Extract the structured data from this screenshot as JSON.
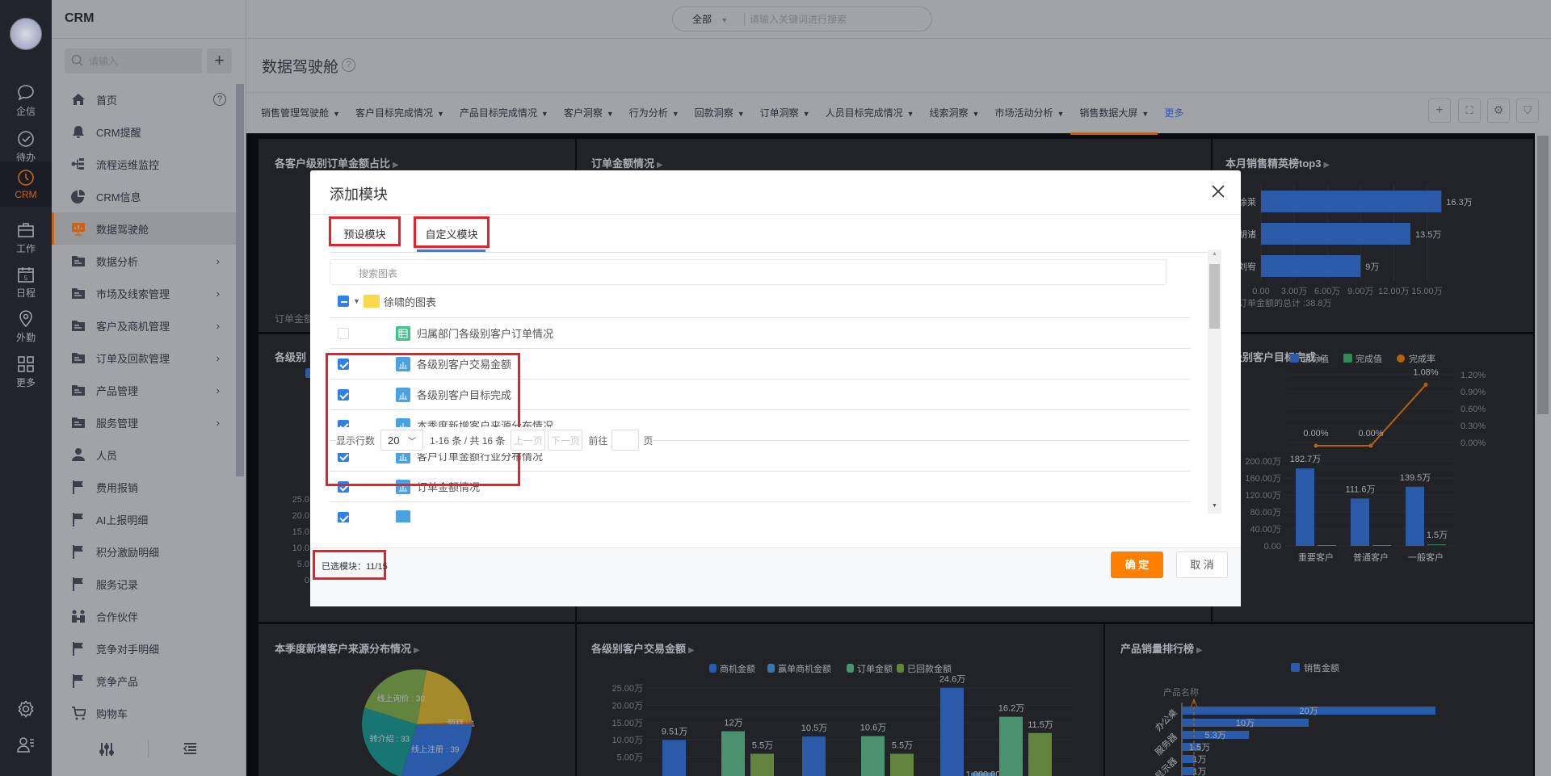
{
  "topbar": {
    "app_title": "CRM",
    "scope": "全部",
    "search_placeholder": "请输入关键词进行搜索"
  },
  "iconbar": {
    "items": [
      {
        "label": "企信",
        "icon": "chat-icon"
      },
      {
        "label": "待办",
        "icon": "check-circle-icon"
      },
      {
        "label": "CRM",
        "icon": "clock-icon",
        "active": true
      },
      {
        "label": "工作",
        "icon": "briefcase-icon"
      },
      {
        "label": "日程",
        "icon": "calendar-icon"
      },
      {
        "label": "外勤",
        "icon": "location-icon"
      },
      {
        "label": "更多",
        "icon": "grid-icon"
      }
    ]
  },
  "sidebar": {
    "search_placeholder": "请输入",
    "items": [
      {
        "label": "首页",
        "icon": "home-icon",
        "help": "?"
      },
      {
        "label": "CRM提醒",
        "icon": "bell-icon"
      },
      {
        "label": "流程运维监控",
        "icon": "flow-icon"
      },
      {
        "label": "CRM信息",
        "icon": "pie-icon"
      },
      {
        "label": "数据驾驶舱",
        "icon": "dashboard-icon",
        "active": true
      },
      {
        "label": "数据分析",
        "icon": "folder-icon",
        "children": true
      },
      {
        "label": "市场及线索管理",
        "icon": "folder-icon",
        "children": true
      },
      {
        "label": "客户及商机管理",
        "icon": "folder-icon",
        "children": true
      },
      {
        "label": "订单及回款管理",
        "icon": "folder-icon",
        "children": true
      },
      {
        "label": "产品管理",
        "icon": "folder-icon",
        "children": true
      },
      {
        "label": "服务管理",
        "icon": "folder-icon",
        "children": true
      },
      {
        "label": "人员",
        "icon": "user-icon"
      },
      {
        "label": "费用报销",
        "icon": "flag-icon"
      },
      {
        "label": "AI上报明细",
        "icon": "flag-icon"
      },
      {
        "label": "积分激励明细",
        "icon": "flag-icon"
      },
      {
        "label": "服务记录",
        "icon": "flag-icon"
      },
      {
        "label": "合作伙伴",
        "icon": "partners-icon"
      },
      {
        "label": "竞争对手明细",
        "icon": "flag-icon"
      },
      {
        "label": "竞争产品",
        "icon": "flag-icon"
      },
      {
        "label": "购物车",
        "icon": "cart-icon"
      }
    ]
  },
  "page": {
    "title": "数据驾驶舱",
    "tabs": [
      "销售管理驾驶舱",
      "客户目标完成情况",
      "产品目标完成情况",
      "客户洞察",
      "行为分析",
      "回款洞察",
      "订单洞察",
      "人员目标完成情况",
      "线索洞察",
      "市场活动分析",
      "销售数据大屏"
    ],
    "active_tab": 10,
    "more_label": "更多"
  },
  "dashboard": {
    "order_share": {
      "title": "各客户级别订单金额占比",
      "footer": "订单金额"
    },
    "order_amount": {
      "title": "订单金额情况"
    },
    "level_partial": {
      "title": "各级别",
      "yticks": [
        "25.0",
        "20.0",
        "15.0",
        "10.0",
        "5.0",
        "0"
      ]
    },
    "top3": {
      "title": "本月销售精英榜top3",
      "names": [
        "徐莱",
        "胡诸",
        "刘宥"
      ],
      "values": [
        16.3,
        13.5,
        9
      ],
      "value_labels": [
        "16.3万",
        "13.5万",
        "9万"
      ],
      "xticks": [
        "0.00",
        "3.00万",
        "6.00万",
        "9.00万",
        "12.00万",
        "15.00万"
      ],
      "xmax": 18,
      "footer": "订单金额的总计 :38.8万"
    },
    "target": {
      "title": "各级别客户目标完成",
      "legend": [
        "目标值",
        "完成值",
        "完成率"
      ],
      "categories": [
        "重要客户",
        "普通客户",
        "一般客户"
      ],
      "target_values": [
        182.7,
        111.6,
        139.5
      ],
      "target_labels": [
        "182.7万",
        "111.6万",
        "139.5万"
      ],
      "done_values": [
        0,
        0,
        1.5
      ],
      "done_labels": [
        "",
        "",
        "1.5万"
      ],
      "rate_values": [
        0,
        0,
        1.08
      ],
      "rate_labels": [
        "0.00%",
        "0.00%",
        "1.08%"
      ],
      "left_ticks": [
        "200.00万",
        "160.00万",
        "120.00万",
        "80.00万",
        "40.00万",
        "0.00"
      ],
      "right_ticks": [
        "1.20%",
        "0.90%",
        "0.60%",
        "0.30%",
        "0.00%"
      ]
    },
    "source": {
      "title": "本季度新增客户来源分布情况",
      "slices": [
        {
          "name": "",
          "value": 28,
          "label": "",
          "color": "#a48a2a"
        },
        {
          "name": "陌拜",
          "value": 1,
          "label": "陌拜 : 1",
          "color": "#b85f14"
        },
        {
          "name": "线上注册",
          "value": 39,
          "label": "线上注册 : 39",
          "color": "#2a5aa8"
        },
        {
          "name": "转介绍",
          "value": 33,
          "label": "转介绍 : 33",
          "color": "#177572"
        },
        {
          "name": "线上询价",
          "value": 30,
          "label": "线上询价 : 30",
          "color": "#62843f"
        }
      ]
    },
    "trade": {
      "title": "各级别客户交易金额",
      "legend": [
        {
          "name": "商机金额",
          "color": "#2a5aa8"
        },
        {
          "name": "赢单商机金额",
          "color": "#3b76a8"
        },
        {
          "name": "订单金额",
          "color": "#4a9270"
        },
        {
          "name": "已回款金额",
          "color": "#62843f"
        }
      ],
      "yticks": [
        "25.00万",
        "20.00万",
        "15.00万",
        "10.00万",
        "5.00万"
      ],
      "groups": [
        [
          9.51,
          0,
          12,
          5.5
        ],
        [
          10.5,
          0,
          10.6,
          5.5
        ],
        [
          24.6,
          0.1,
          16.2,
          11.5
        ]
      ],
      "labels": [
        [
          "9.51万",
          "",
          "12万",
          "5.5万"
        ],
        [
          "10.5万",
          "",
          "10.6万",
          "5.5万"
        ],
        [
          "24.6万",
          "1,000.00",
          "16.2万",
          "11.5万"
        ]
      ]
    },
    "products": {
      "title": "产品销量排行榜",
      "legend": "销售金额",
      "axis_name": "产品名称",
      "ylabels": [
        "办公桌",
        "服务器",
        "显示器"
      ],
      "values": [
        20,
        10,
        5.3,
        1.5,
        1,
        1
      ],
      "value_labels": [
        "20万",
        "10万",
        "5.3万",
        "1.5万",
        "1万",
        "1万"
      ]
    }
  },
  "modal": {
    "title": "添加模块",
    "tabs": [
      "预设模块",
      "自定义模块"
    ],
    "active_tab": 1,
    "search_placeholder": "搜索图表",
    "folder": {
      "name": "徐啸的图表",
      "state": "partial"
    },
    "rows": [
      {
        "label": "归属部门各级别客户订单情况",
        "checked": false,
        "type": "table"
      },
      {
        "label": "各级别客户交易金额",
        "checked": true,
        "type": "chart"
      },
      {
        "label": "各级别客户目标完成",
        "checked": true,
        "type": "chart"
      },
      {
        "label": "本季度新增客户来源分布情况",
        "checked": true,
        "type": "chart"
      },
      {
        "label": "客户订单金额行业分布情况",
        "checked": true,
        "type": "chart"
      },
      {
        "label": "订单金额情况",
        "checked": true,
        "type": "chart"
      }
    ],
    "pager": {
      "rows_label": "显示行数",
      "page_size": "20",
      "range": "1-16 条 / 共 16 条",
      "prev": "上一页",
      "next": "下一页",
      "goto": "前往",
      "goto_value": "",
      "unit": "页"
    },
    "footer": {
      "selected_label": "已选模块：",
      "selected_value": "11/15",
      "confirm": "确 定",
      "cancel": "取 消"
    }
  }
}
